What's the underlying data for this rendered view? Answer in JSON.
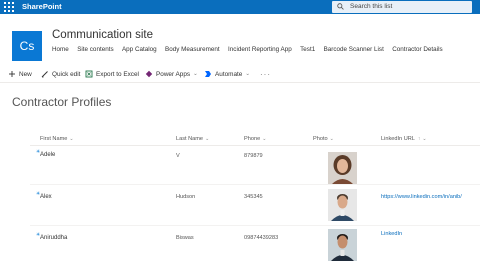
{
  "suite": {
    "brand": "SharePoint",
    "search_placeholder": "Search this list"
  },
  "site": {
    "logo_initials": "Cs",
    "title": "Communication site",
    "nav": [
      "Home",
      "Site contents",
      "App Catalog",
      "Body Measurement",
      "Incident Reporting App",
      "Test1",
      "Barcode Scanner List",
      "Contractor Details"
    ]
  },
  "commands": {
    "new": "New",
    "quick_edit": "Quick edit",
    "export": "Export to Excel",
    "power_apps": "Power Apps",
    "automate": "Automate",
    "more": "···"
  },
  "list": {
    "title": "Contractor Profiles",
    "columns": {
      "first_name": "First Name",
      "last_name": "Last Name",
      "phone": "Phone",
      "photo": "Photo",
      "linkedin": "LinkedIn URL",
      "sort_indicator": "↑"
    },
    "rows": [
      {
        "first_name": "Adele",
        "last_name": "V",
        "phone": "879879",
        "linkedin": ""
      },
      {
        "first_name": "Alex",
        "last_name": "Hudson",
        "phone": "345345",
        "linkedin": "https://www.linkedin.com/in/anib/"
      },
      {
        "first_name": "Aniruddha",
        "last_name": "Biswas",
        "phone": "09874439283",
        "linkedin": "LinkedIn"
      }
    ]
  },
  "colors": {
    "suitebar": "#0a6ebd",
    "logo": "#0a78d4",
    "link": "#0a6ebd"
  },
  "icons": [
    "app-launcher-icon",
    "search-icon",
    "plus-icon",
    "quick-edit-icon",
    "excel-icon",
    "power-apps-icon",
    "automate-icon"
  ]
}
